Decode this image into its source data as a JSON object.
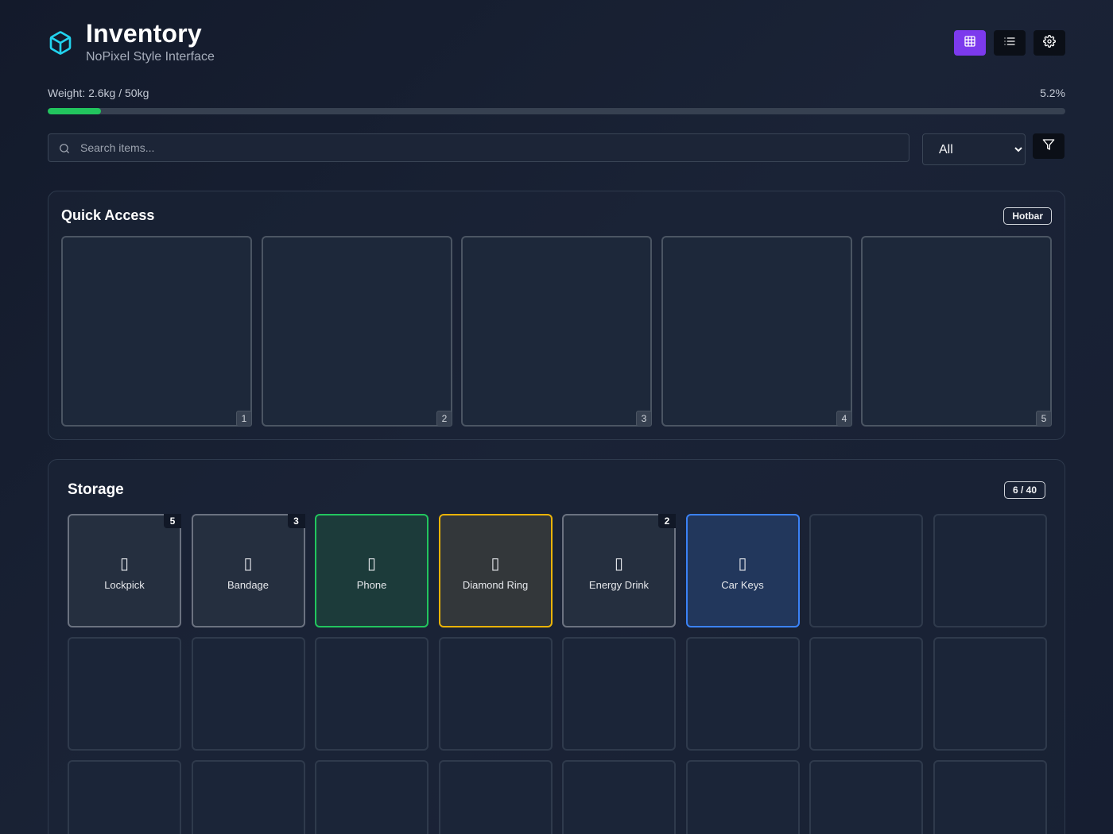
{
  "header": {
    "title": "Inventory",
    "subtitle": "NoPixel Style Interface",
    "logo_icon": "cube-icon",
    "view_buttons": [
      {
        "name": "grid-view-button",
        "icon": "grid-icon",
        "active": true
      },
      {
        "name": "list-view-button",
        "icon": "list-icon",
        "active": false
      },
      {
        "name": "settings-button",
        "icon": "gear-icon",
        "active": false
      }
    ],
    "accent_color": "#7c3aed"
  },
  "weight": {
    "label": "Weight: 2.6kg / 50kg",
    "percent_label": "5.2%",
    "fraction": 0.052,
    "bar_color": "#22c55e"
  },
  "search": {
    "placeholder": "Search items...",
    "value": ""
  },
  "filter": {
    "selected": "All",
    "icon": "filter-icon"
  },
  "quick_access": {
    "title": "Quick Access",
    "badge": "Hotbar",
    "slots": [
      "1",
      "2",
      "3",
      "4",
      "5"
    ]
  },
  "storage": {
    "title": "Storage",
    "badge": "6 / 40",
    "items": [
      {
        "name": "Lockpick",
        "qty": "5",
        "rarity": "common",
        "icon": "lockpick-icon"
      },
      {
        "name": "Bandage",
        "qty": "3",
        "rarity": "common",
        "icon": "bandage-icon"
      },
      {
        "name": "Phone",
        "qty": "",
        "rarity": "uncommon",
        "icon": "phone-icon"
      },
      {
        "name": "Diamond Ring",
        "qty": "",
        "rarity": "legendary",
        "icon": "ring-icon"
      },
      {
        "name": "Energy Drink",
        "qty": "2",
        "rarity": "common",
        "icon": "drink-icon"
      },
      {
        "name": "Car Keys",
        "qty": "",
        "rarity": "rare",
        "icon": "key-icon"
      }
    ],
    "rarity_colors": {
      "common": "#6b7280",
      "uncommon": "#22c55e",
      "legendary": "#eab308",
      "rare": "#3b82f6"
    }
  }
}
